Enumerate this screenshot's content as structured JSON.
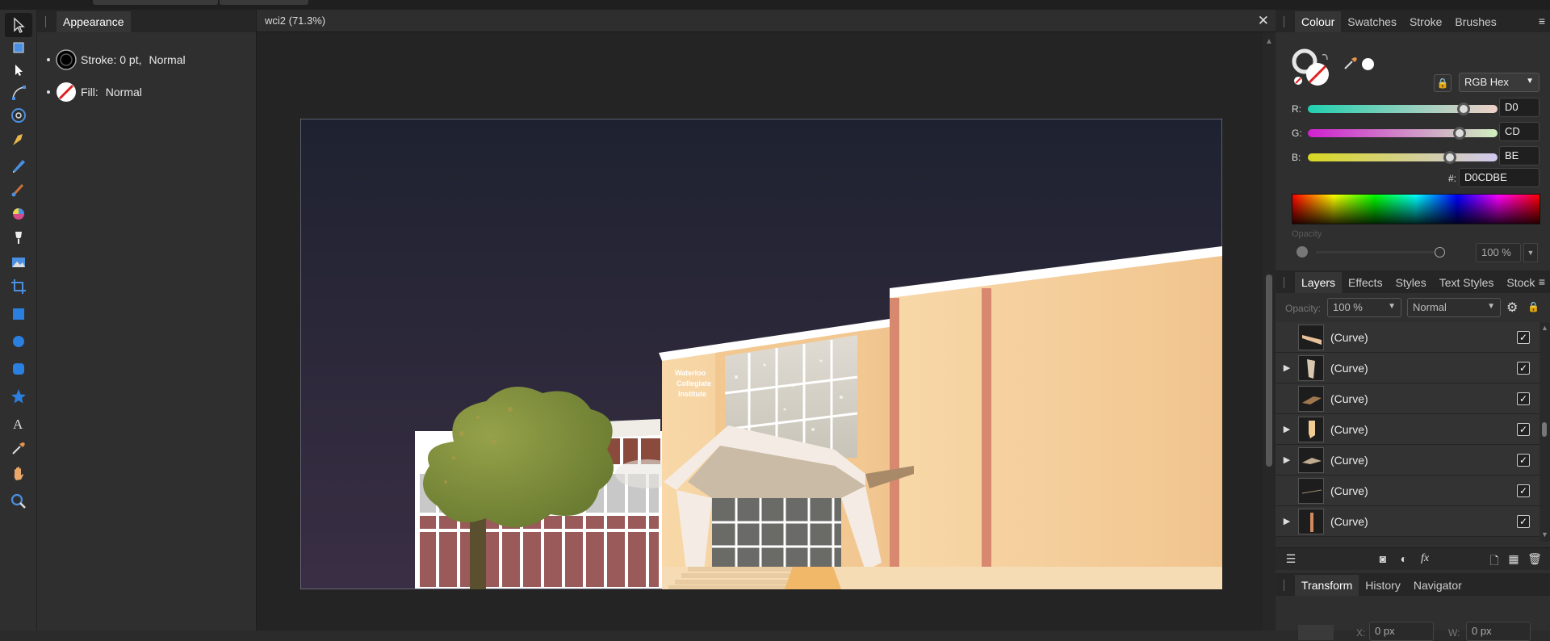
{
  "appearance": {
    "tab_label": "Appearance",
    "stroke_label": "Stroke: 0 pt,",
    "stroke_mode": "Normal",
    "fill_label": "Fill:",
    "fill_mode": "Normal"
  },
  "document": {
    "tab_title": "wci2 (71.3%)",
    "close_glyph": "✕",
    "sign_text": [
      "Waterloo",
      "Collegiate",
      "Institute"
    ]
  },
  "colour_panel": {
    "tabs": [
      "Colour",
      "Swatches",
      "Stroke",
      "Brushes"
    ],
    "mode": "RGB Hex",
    "channels": [
      {
        "label": "R:",
        "value": "D0",
        "level": 0.82
      },
      {
        "label": "G:",
        "value": "CD",
        "level": 0.8
      },
      {
        "label": "B:",
        "value": "BE",
        "level": 0.75
      }
    ],
    "hex_label": "#:",
    "hex_value": "D0CDBE",
    "opacity_label": "Opacity",
    "opacity_value": "100 %",
    "current_colour": "#D0CDBE"
  },
  "layers_panel": {
    "tabs": [
      "Layers",
      "Effects",
      "Styles",
      "Text Styles",
      "Stock"
    ],
    "opacity_label": "Opacity:",
    "opacity_value": "100 %",
    "blend_mode": "Normal",
    "layers": [
      {
        "name": "(Curve)",
        "expandable": false,
        "visible": true
      },
      {
        "name": "(Curve)",
        "expandable": true,
        "visible": true
      },
      {
        "name": "(Curve)",
        "expandable": false,
        "visible": true
      },
      {
        "name": "(Curve)",
        "expandable": true,
        "visible": true
      },
      {
        "name": "(Curve)",
        "expandable": true,
        "visible": true
      },
      {
        "name": "(Curve)",
        "expandable": false,
        "visible": true
      },
      {
        "name": "(Curve)",
        "expandable": true,
        "visible": true
      }
    ]
  },
  "transform_panel": {
    "tabs": [
      "Transform",
      "History",
      "Navigator"
    ],
    "x_label": "X:",
    "x_value": "0 px",
    "w_label": "W:",
    "w_value": "0 px"
  },
  "colors": {
    "accent": "#2a6fd6",
    "sky_top": "#1e2230",
    "sky_bottom": "#3a2e44",
    "wall": "#f5cf9a",
    "tree": "#7f8e3c"
  }
}
